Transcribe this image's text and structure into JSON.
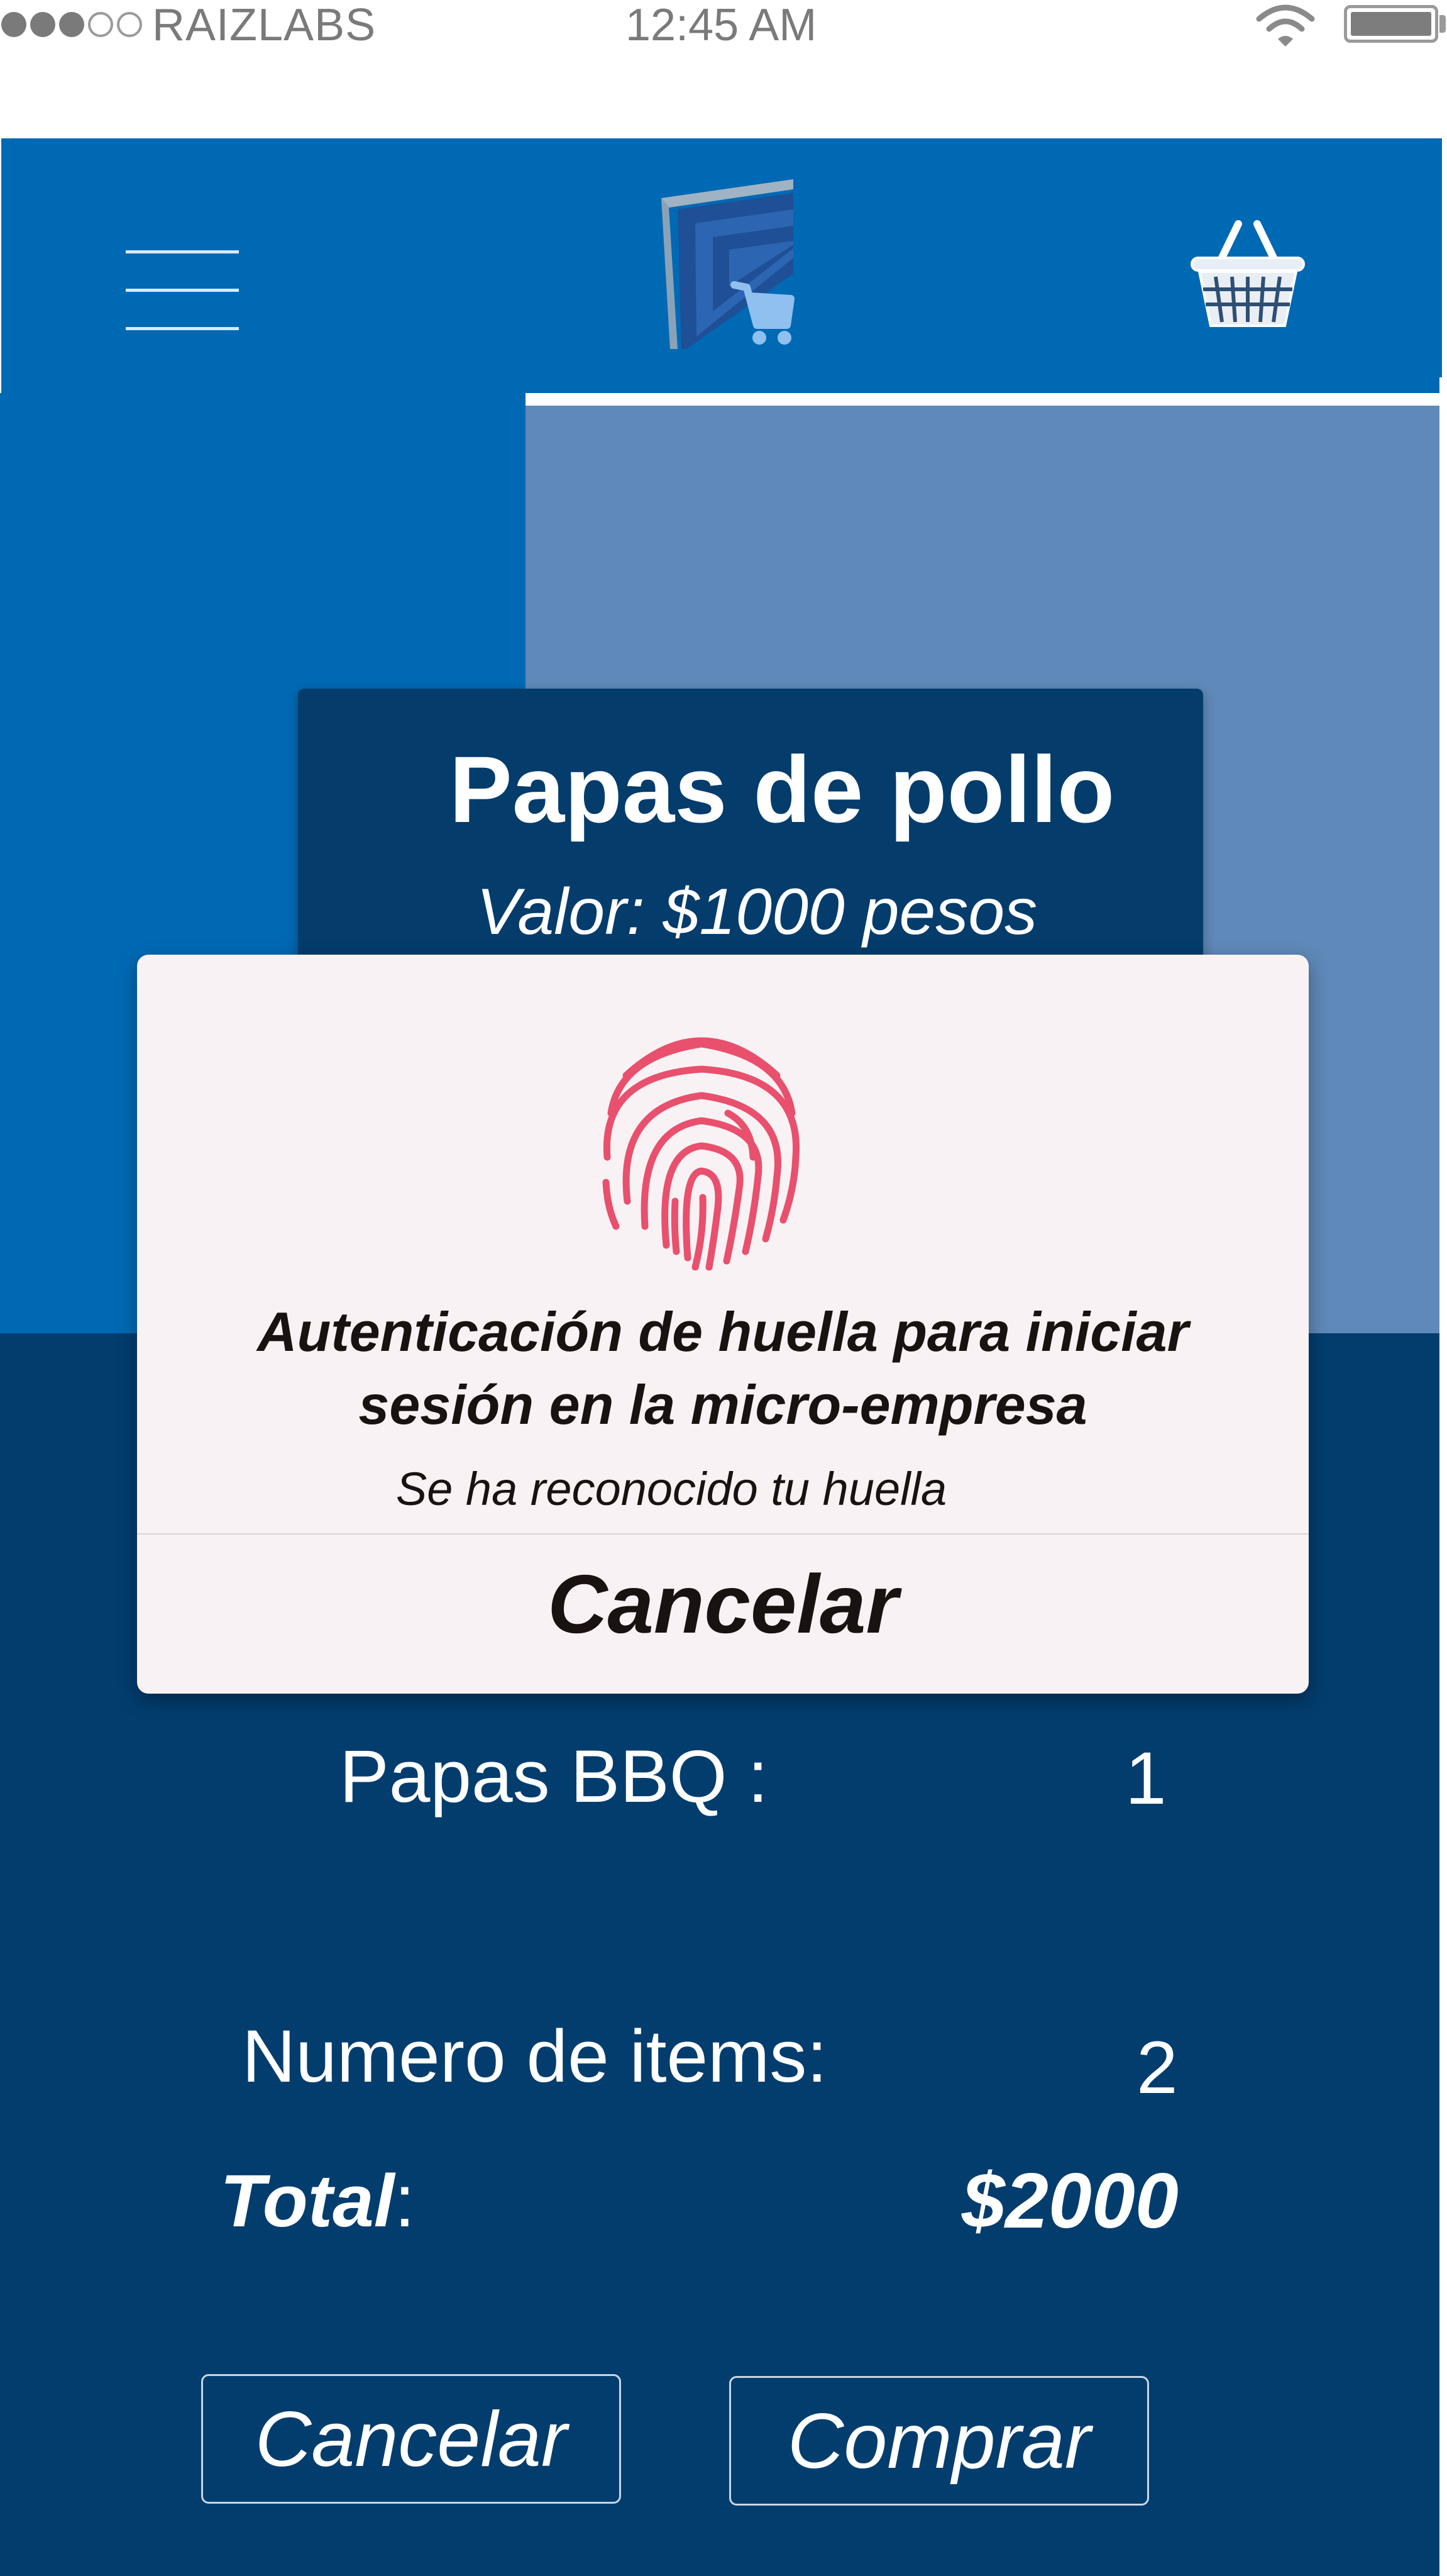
{
  "status_bar": {
    "signal_filled": 3,
    "signal_total": 5,
    "carrier": "RAIZLABS",
    "time": "12:45 AM",
    "wifi_icon": "wifi-icon",
    "battery_icon": "battery-icon",
    "battery_level": 1.0
  },
  "header": {
    "menu_icon": "hamburger-menu-icon",
    "logo_icon": "shopping-cart-logo-icon",
    "cart_icon": "shopping-basket-icon"
  },
  "product": {
    "title": "Papas de pollo",
    "price": "Valor: $1000  pesos"
  },
  "order": {
    "item_label": "Papas BBQ :",
    "item_qty": "1",
    "items_label": "Numero de items:",
    "items_value": "2",
    "total_label": "Total",
    "total_colon": ":",
    "total_value": "$2000"
  },
  "buttons": {
    "cancel": "Cancelar",
    "buy": "Comprar"
  },
  "modal": {
    "icon": "fingerprint-icon",
    "title_line1": "Autenticación de huella para iniciar",
    "title_line2": "sesión en la micro-empresa",
    "subtitle": "Se ha reconocido tu huella",
    "cancel": "Cancelar"
  },
  "colors": {
    "header_blue": "#0069b4",
    "panel_light": "#5f89b9",
    "panel_dark": "#033d6e",
    "fingerprint": "#e8506d",
    "modal_bg": "#f8f2f4"
  }
}
